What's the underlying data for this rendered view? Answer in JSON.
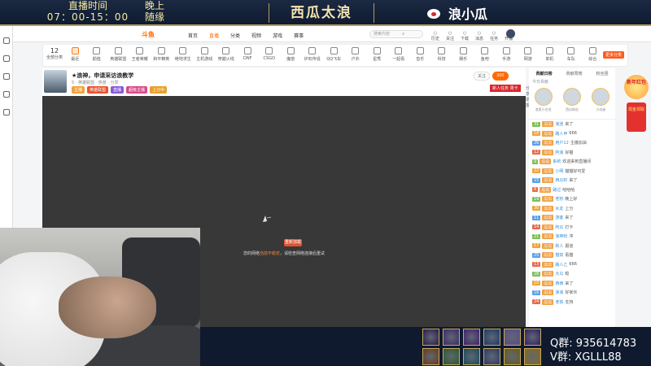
{
  "overlay": {
    "live_label": "直播时间",
    "live_value": "晚上",
    "live_time": "07：00-15：00",
    "live_extra": "随缘",
    "brand": "西瓜太浪",
    "weibo_name": "浪小瓜",
    "qq_line": "Q群: 935614783",
    "wechat_line": "V群: XGLLL88",
    "colors": {
      "gold": "#b89a5e",
      "banner_bg": "#0e1a2f",
      "weibo_red": "#d8262d"
    }
  },
  "site": {
    "logo": "斗鱼",
    "nav": [
      "首页",
      "直播",
      "分类",
      "视频",
      "游戏",
      "赛事"
    ],
    "nav_active_index": 1,
    "search_placeholder": "搜索内容",
    "nav_right": [
      "历史",
      "关注",
      "下载",
      "消息",
      "任务",
      "开播"
    ],
    "accent": "#ff6a00"
  },
  "categories": {
    "first_label": "全部分类",
    "first_count": "12",
    "items": [
      "最近",
      "颜值",
      "英雄联盟",
      "王者荣耀",
      "和平精英",
      "绝地求生",
      "主机游戏",
      "穿越火线",
      "DNF",
      "CSGO",
      "魔兽",
      "炉石传说",
      "QQ飞车",
      "户外",
      "星秀",
      "一起看",
      "音乐",
      "科技",
      "娱乐",
      "鱼吧",
      "手游",
      "网游",
      "单机",
      "车队",
      "综合"
    ],
    "more": "更多分类"
  },
  "room": {
    "title": "★浪神，申请采访浪教学",
    "meta": "5 · 英雄联盟 · 热度 · 分享",
    "tags": [
      "主播",
      "英雄联盟",
      "直播",
      "超级主播",
      "上分中"
    ],
    "follow": "关注",
    "follow_count": "300",
    "activity": "新人任务 周卡",
    "head_right": "分享 举报"
  },
  "player": {
    "button": "重新加载",
    "message_pre": "您的网络",
    "message_link": "当前不稳定",
    "message_post": "，请检查网络连接后重试",
    "bg": "#383838"
  },
  "side": {
    "tabs": [
      "贡献日榜",
      "贡献周榜",
      "粉丝团"
    ],
    "rank_label": "今日贡献",
    "top3": [
      "浪里小白龙",
      "西瓜粉丝",
      "小瓜迷"
    ],
    "chat": [
      {
        "lv": "31",
        "badge": "瓜瓜",
        "nick": "浪迷",
        "text": "来了"
      },
      {
        "lv": "18",
        "badge": "瓜瓜",
        "nick": "路人甲",
        "text": "666"
      },
      {
        "lv": "26",
        "badge": "瓜瓜",
        "nick": "用户12",
        "text": "主播加油"
      },
      {
        "lv": "12",
        "badge": "瓜瓜",
        "nick": "阿浪",
        "text": "好猫"
      },
      {
        "lv": "9",
        "badge": "瓜瓜",
        "nick": "系统",
        "text": "欢迎来到直播间"
      },
      {
        "lv": "22",
        "badge": "瓜瓜",
        "nick": "小明",
        "text": "猫猫好可爱"
      },
      {
        "lv": "15",
        "badge": "瓜瓜",
        "nick": "西瓜籽",
        "text": "来了"
      },
      {
        "lv": "8",
        "badge": "瓜瓜",
        "nick": "路过",
        "text": "哈哈哈"
      },
      {
        "lv": "19",
        "badge": "瓜瓜",
        "nick": "老粉",
        "text": "晚上好"
      },
      {
        "lv": "30",
        "badge": "瓜瓜",
        "nick": "水友",
        "text": "上分"
      },
      {
        "lv": "11",
        "badge": "瓜瓜",
        "nick": "游客",
        "text": "来了"
      },
      {
        "lv": "14",
        "badge": "瓜瓜",
        "nick": "阿瓜",
        "text": "打卡"
      },
      {
        "lv": "21",
        "badge": "瓜瓜",
        "nick": "浪神粉",
        "text": "冲"
      },
      {
        "lv": "17",
        "badge": "瓜瓜",
        "nick": "新人",
        "text": "报道"
      },
      {
        "lv": "25",
        "badge": "瓜瓜",
        "nick": "猫奴",
        "text": "看猫"
      },
      {
        "lv": "13",
        "badge": "瓜瓜",
        "nick": "路人乙",
        "text": "666"
      },
      {
        "lv": "28",
        "badge": "瓜瓜",
        "nick": "大瓜",
        "text": "稳"
      },
      {
        "lv": "10",
        "badge": "瓜瓜",
        "nick": "西西",
        "text": "来了"
      },
      {
        "lv": "16",
        "badge": "瓜瓜",
        "nick": "浪浪",
        "text": "好家伙"
      },
      {
        "lv": "24",
        "badge": "瓜瓜",
        "nick": "老铁",
        "text": "支持"
      }
    ]
  },
  "promo": {
    "ribbon": "新年红包",
    "packet": "现金领取"
  },
  "skills": {
    "icons": [
      "dark-skill-icon",
      "purple-skill-icon",
      "blade-skill-icon",
      "ice-skill-icon",
      "rune-skill-icon",
      "void-skill-icon",
      "flame-skill-icon",
      "heal-skill-icon",
      "shield-skill-icon",
      "orb-skill-icon",
      "strike-skill-icon",
      "flash-skill-icon"
    ],
    "colors": [
      "#2a1a4a",
      "#3a2a6a",
      "#40206a",
      "#1a3a6a",
      "#5a4a8a",
      "#30206a",
      "#6a3a1a",
      "#2a5a2a",
      "#1a4a5a",
      "#2a3a6a",
      "#6a5a1a",
      "#8a6a1a"
    ]
  }
}
